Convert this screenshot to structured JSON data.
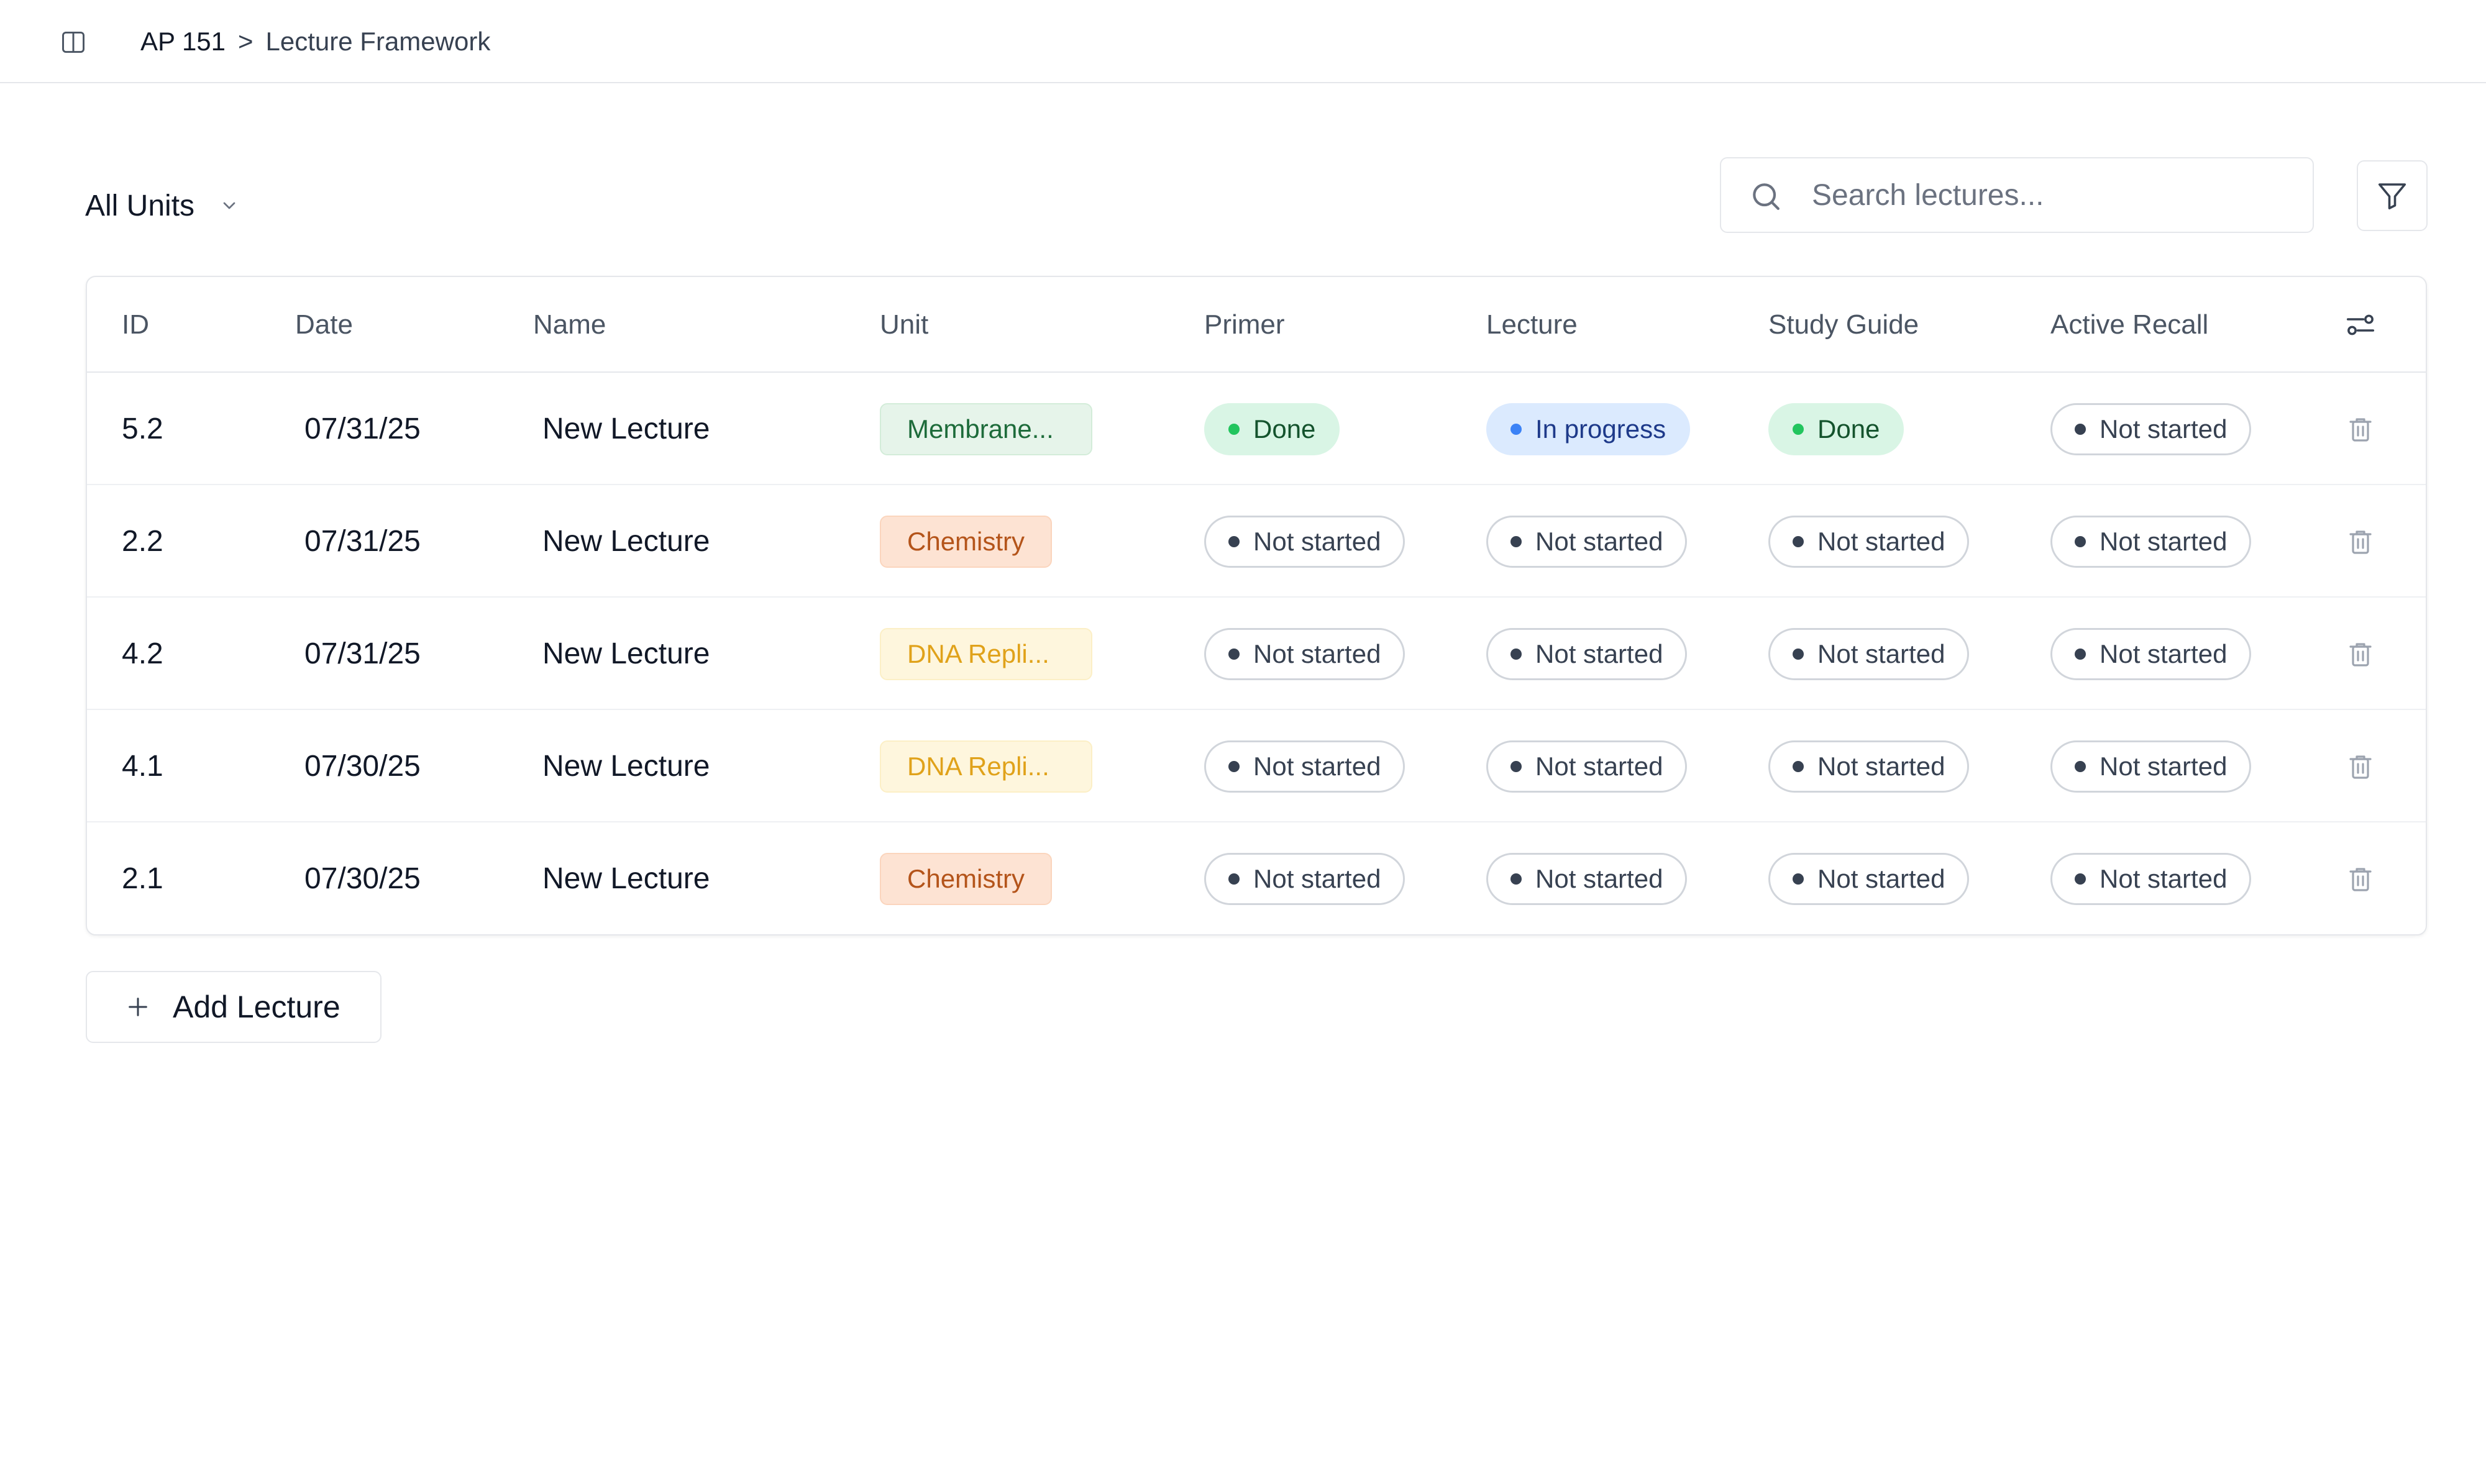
{
  "breadcrumb": {
    "root": "AP 151",
    "separator": ">",
    "current": "Lecture Framework"
  },
  "toolbar": {
    "unit_filter_value": "All Units",
    "search_placeholder": "Search lectures...",
    "search_value": ""
  },
  "table": {
    "headers": {
      "id": "ID",
      "date": "Date",
      "name": "Name",
      "unit": "Unit",
      "primer": "Primer",
      "lecture": "Lecture",
      "study_guide": "Study Guide",
      "active_recall": "Active Recall"
    },
    "rows": [
      {
        "id": "5.2",
        "date": "07/31/25",
        "name": "New Lecture",
        "unit": "Membrane...",
        "unit_style": "membrane",
        "primer": "Done",
        "lecture": "In progress",
        "study_guide": "Done",
        "active_recall": "Not started"
      },
      {
        "id": "2.2",
        "date": "07/31/25",
        "name": "New Lecture",
        "unit": "Chemistry",
        "unit_style": "chemistry",
        "primer": "Not started",
        "lecture": "Not started",
        "study_guide": "Not started",
        "active_recall": "Not started"
      },
      {
        "id": "4.2",
        "date": "07/31/25",
        "name": "New Lecture",
        "unit": "DNA Repli...",
        "unit_style": "dna",
        "primer": "Not started",
        "lecture": "Not started",
        "study_guide": "Not started",
        "active_recall": "Not started"
      },
      {
        "id": "4.1",
        "date": "07/30/25",
        "name": "New Lecture",
        "unit": "DNA Repli...",
        "unit_style": "dna",
        "primer": "Not started",
        "lecture": "Not started",
        "study_guide": "Not started",
        "active_recall": "Not started"
      },
      {
        "id": "2.1",
        "date": "07/30/25",
        "name": "New Lecture",
        "unit": "Chemistry",
        "unit_style": "chemistry",
        "primer": "Not started",
        "lecture": "Not started",
        "study_guide": "Not started",
        "active_recall": "Not started"
      }
    ]
  },
  "actions": {
    "add_lecture_label": "Add Lecture"
  },
  "icons": {
    "sidebar_toggle": "sidebar-toggle-icon",
    "unit_dropdown": "chevron-down-icon",
    "search": "search-icon",
    "filter": "filter-icon",
    "column_settings": "settings-sliders-icon",
    "row_delete": "trash-icon",
    "add": "plus-icon"
  },
  "colors": {
    "done": "#22c55e",
    "in_progress": "#3b82f6",
    "not_started": "#374151",
    "membrane_tag": "#e6f4ea",
    "chemistry_tag": "#fde3d3",
    "dna_tag": "#fef6dd"
  }
}
